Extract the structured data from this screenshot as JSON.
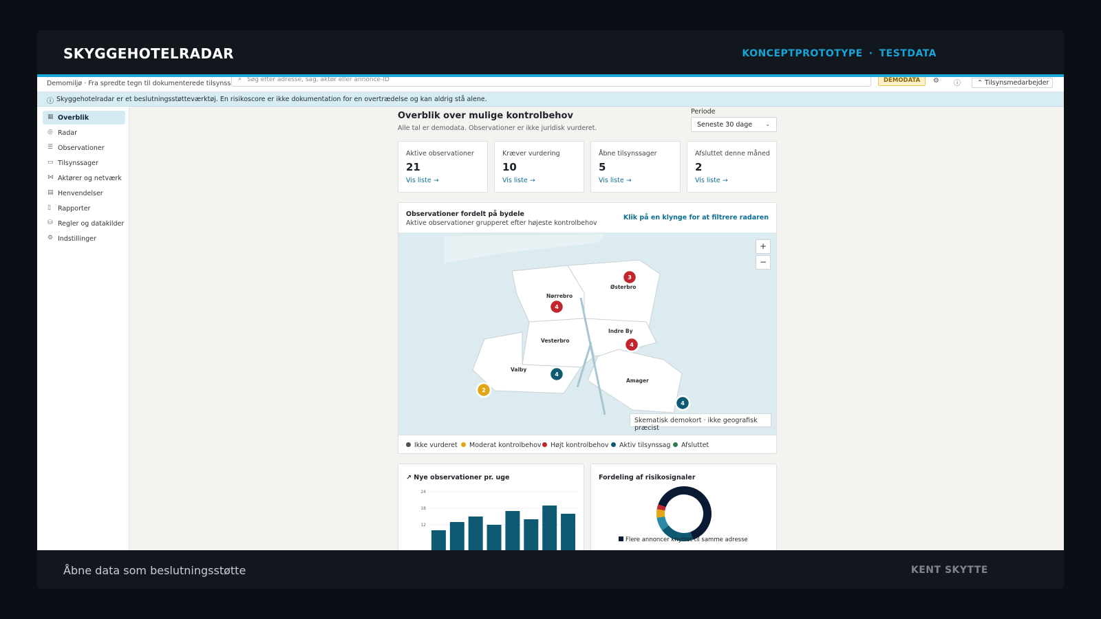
{
  "frame": {
    "brand": "SKYGGEHOTELRADAR",
    "tagline_left": "KONCEPTPROTOTYPE",
    "tagline_sep": "·",
    "tagline_right": "TESTDATA",
    "footer_left": "Åbne data som beslutningsstøtte",
    "footer_right": "KENT SKYTTE"
  },
  "app": {
    "env_text": "Demomiljø · Fra spredte tegn til dokumenterede tilsynssager",
    "search_placeholder": "Søg efter adresse, sag, aktør eller annonce-ID",
    "demo_badge": "DEMODATA",
    "user_button": "Tilsynsmedarbejder",
    "info_text": "Skyggehotelradar er et beslutningsstøtteværktøj. En risikoscore er ikke dokumentation for en overtrædelse og kan aldrig stå alene."
  },
  "sidebar": {
    "items": [
      {
        "label": "Overblik",
        "icon": "grid-icon",
        "active": true
      },
      {
        "label": "Radar",
        "icon": "radar-icon"
      },
      {
        "label": "Observationer",
        "icon": "list-icon"
      },
      {
        "label": "Tilsynssager",
        "icon": "folder-icon"
      },
      {
        "label": "Aktører og netværk",
        "icon": "network-icon"
      },
      {
        "label": "Henvendelser",
        "icon": "inbox-icon"
      },
      {
        "label": "Rapporter",
        "icon": "document-icon"
      },
      {
        "label": "Regler og datakilder",
        "icon": "database-icon"
      },
      {
        "label": "Indstillinger",
        "icon": "gear-icon"
      }
    ]
  },
  "overview": {
    "title": "Overblik over mulige kontrolbehov",
    "subtitle": "Alle tal er demodata. Observationer er ikke juridisk vurderet.",
    "period_label": "Periode",
    "period_value": "Seneste 30 dage",
    "kpis": [
      {
        "label": "Aktive observationer",
        "value": "21",
        "link": "Vis liste →"
      },
      {
        "label": "Kræver vurdering",
        "value": "10",
        "link": "Vis liste →"
      },
      {
        "label": "Åbne tilsynssager",
        "value": "5",
        "link": "Vis liste →"
      },
      {
        "label": "Afsluttet denne måned",
        "value": "2",
        "link": "Vis liste →"
      }
    ]
  },
  "map": {
    "title": "Observationer fordelt på bydele",
    "subtitle": "Aktive observationer grupperet efter højeste kontrolbehov",
    "hint": "Klik på en klynge for at filtrere radaren",
    "zoom_in": "+",
    "zoom_out": "−",
    "note": "Skematisk demokort · ikke geografisk præcist",
    "districts": [
      "Nørrebro",
      "Østerbro",
      "Vesterbro",
      "Indre By",
      "Valby",
      "Amager"
    ],
    "clusters": [
      {
        "count": "3",
        "color": "#c0262d"
      },
      {
        "count": "4",
        "color": "#c0262d"
      },
      {
        "count": "4",
        "color": "#c0262d"
      },
      {
        "count": "4",
        "color": "#0e5a73"
      },
      {
        "count": "2",
        "color": "#e3a417"
      },
      {
        "count": "4",
        "color": "#0e5a73"
      }
    ],
    "legend": [
      {
        "label": "Ikke vurderet",
        "color": "#4a4f56"
      },
      {
        "label": "Moderat kontrolbehov",
        "color": "#e3a417"
      },
      {
        "label": "Højt kontrolbehov",
        "color": "#c0262d"
      },
      {
        "label": "Aktiv tilsynssag",
        "color": "#0e5a73"
      },
      {
        "label": "Afsluttet",
        "color": "#2e7d4a"
      }
    ]
  },
  "charts": {
    "weekly_title": "Nye observationer pr. uge",
    "risk_title": "Fordeling af risikosignaler",
    "risk_legend_first": "Flere annoncer knyttet til samme adresse"
  },
  "chart_data": [
    {
      "type": "bar",
      "title": "Nye observationer pr. uge",
      "y_ticks": [
        "24",
        "18",
        "12"
      ],
      "values": [
        10,
        13,
        15,
        12,
        17,
        14,
        19,
        16
      ],
      "ylim": [
        6,
        24
      ],
      "color": "#0e5a73"
    },
    {
      "type": "pie",
      "title": "Fordeling af risikosignaler",
      "values": [
        64,
        20,
        8,
        5,
        3
      ],
      "colors": [
        "#0b1a33",
        "#0e5a73",
        "#2a8aa8",
        "#e3a417",
        "#c0262d"
      ]
    }
  ]
}
